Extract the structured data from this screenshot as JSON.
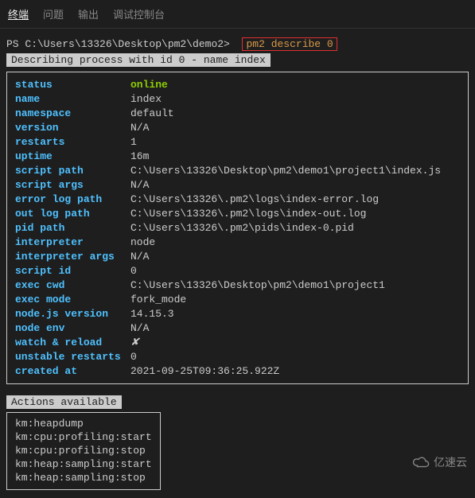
{
  "tabs": {
    "terminal": "终端",
    "problems": "问题",
    "output": "输出",
    "debugConsole": "调试控制台"
  },
  "prompt": {
    "prefix": "PS C:\\Users\\13326\\Desktop\\pm2\\demo2>",
    "command": "pm2 describe 0"
  },
  "describeHeader": " Describing process with id 0 - name index ",
  "proc": {
    "status_k": "status",
    "status_v": "online",
    "name_k": "name",
    "name_v": "index",
    "namespace_k": "namespace",
    "namespace_v": "default",
    "version_k": "version",
    "version_v": "N/A",
    "restarts_k": "restarts",
    "restarts_v": "1",
    "uptime_k": "uptime",
    "uptime_v": "16m",
    "scriptpath_k": "script path",
    "scriptpath_v": "C:\\Users\\13326\\Desktop\\pm2\\demo1\\project1\\index.js",
    "scriptargs_k": "script args",
    "scriptargs_v": "N/A",
    "errorlog_k": "error log path",
    "errorlog_v": "C:\\Users\\13326\\.pm2\\logs\\index-error.log",
    "outlog_k": "out log path",
    "outlog_v": "C:\\Users\\13326\\.pm2\\logs\\index-out.log",
    "pidpath_k": "pid path",
    "pidpath_v": "C:\\Users\\13326\\.pm2\\pids\\index-0.pid",
    "interpreter_k": "interpreter",
    "interpreter_v": "node",
    "interpreterargs_k": "interpreter args",
    "interpreterargs_v": "N/A",
    "scriptid_k": "script id",
    "scriptid_v": "0",
    "execcwd_k": "exec cwd",
    "execcwd_v": "C:\\Users\\13326\\Desktop\\pm2\\demo1\\project1",
    "execmode_k": "exec mode",
    "execmode_v": "fork_mode",
    "nodever_k": "node.js version",
    "nodever_v": "14.15.3",
    "nodeenv_k": "node env",
    "nodeenv_v": "N/A",
    "watch_k": "watch & reload",
    "watch_v": "✘",
    "unstable_k": "unstable restarts",
    "unstable_v": "0",
    "created_k": "created at",
    "created_v": "2021-09-25T09:36:25.922Z"
  },
  "actionsHeader": " Actions available ",
  "actions": {
    "a0": "km:heapdump",
    "a1": "km:cpu:profiling:start",
    "a2": "km:cpu:profiling:stop",
    "a3": "km:heap:sampling:start",
    "a4": "km:heap:sampling:stop"
  },
  "watermark": "亿速云"
}
